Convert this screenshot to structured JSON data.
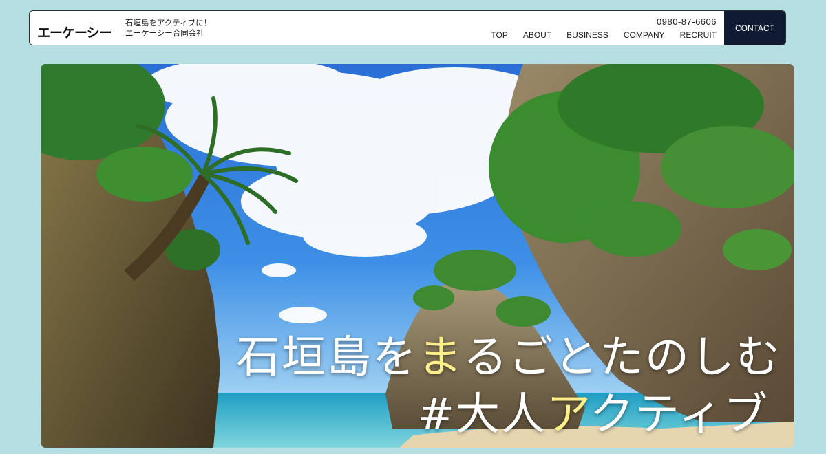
{
  "header": {
    "logo_text": "エーケーシー",
    "tagline_line1": "石垣島をアクティブに！",
    "tagline_line2": "エーケーシー合同会社",
    "phone": "0980-87-6606",
    "nav": [
      "TOP",
      "ABOUT",
      "BUSINESS",
      "COMPANY",
      "RECRUIT"
    ],
    "contact_label": "CONTACT"
  },
  "hero": {
    "headline1_a": "石垣島を",
    "headline1_hl": "ま",
    "headline1_b": "るごとたのしむ",
    "headline2_a": "#大人",
    "headline2_hl": "ア",
    "headline2_b": "クティブ",
    "image_desc": "beach-rocks-palms-photo"
  },
  "colors": {
    "page_bg": "#b6dfe3",
    "contact_bg": "#0f1a33",
    "highlight": "#fdf08a"
  }
}
